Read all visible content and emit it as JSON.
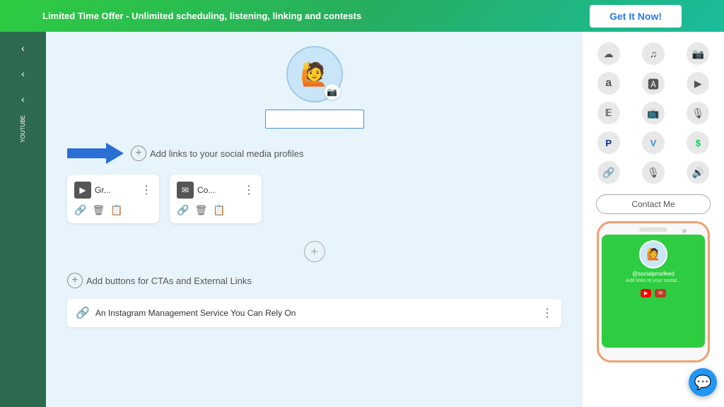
{
  "banner": {
    "offer_text": "Limited Time Offer - Unlimited scheduling, listening, linking and contests",
    "cta_label": "Get It Now!"
  },
  "profile": {
    "avatar_emoji": "🙋",
    "placeholder": ""
  },
  "social_links": {
    "add_label": "Add links to your social media profiles",
    "cards": [
      {
        "title": "Gr...",
        "icon": "▶"
      },
      {
        "title": "Co...",
        "icon": "✉"
      }
    ]
  },
  "cta_section": {
    "add_label": "Add buttons for CTAs and External Links"
  },
  "bio": {
    "icon": "🔗",
    "text": "An Instagram Management Service You Can Rely On"
  },
  "right_panel": {
    "social_icons": [
      {
        "icon": "🎵",
        "name": "soundcloud"
      },
      {
        "icon": "🎵",
        "name": "spotify"
      },
      {
        "icon": "📷",
        "name": "instagram"
      },
      {
        "icon": "🅰",
        "name": "amazon"
      },
      {
        "icon": "🅰",
        "name": "appstore"
      },
      {
        "icon": "▶",
        "name": "google-play"
      },
      {
        "icon": "𝔼",
        "name": "etsy"
      },
      {
        "icon": "📺",
        "name": "twitch"
      },
      {
        "icon": "🎙",
        "name": "podcast"
      },
      {
        "icon": "P",
        "name": "paypal"
      },
      {
        "icon": "V",
        "name": "venmo"
      },
      {
        "icon": "$",
        "name": "cashapp"
      },
      {
        "icon": "🔗",
        "name": "link"
      },
      {
        "icon": "🎙",
        "name": "anchor"
      },
      {
        "icon": "🔊",
        "name": "audio"
      }
    ],
    "contact_label": "Contact Me"
  },
  "phone": {
    "username": "@socialproxfeed",
    "link_text": "Add links to your social...",
    "btn_yt": "▶",
    "btn_mail": "✉"
  },
  "sidebar": {
    "youtube_label": "YOUTUBE",
    "chevrons": [
      "›",
      "›",
      "›"
    ]
  },
  "chat": {
    "icon": "💬"
  }
}
